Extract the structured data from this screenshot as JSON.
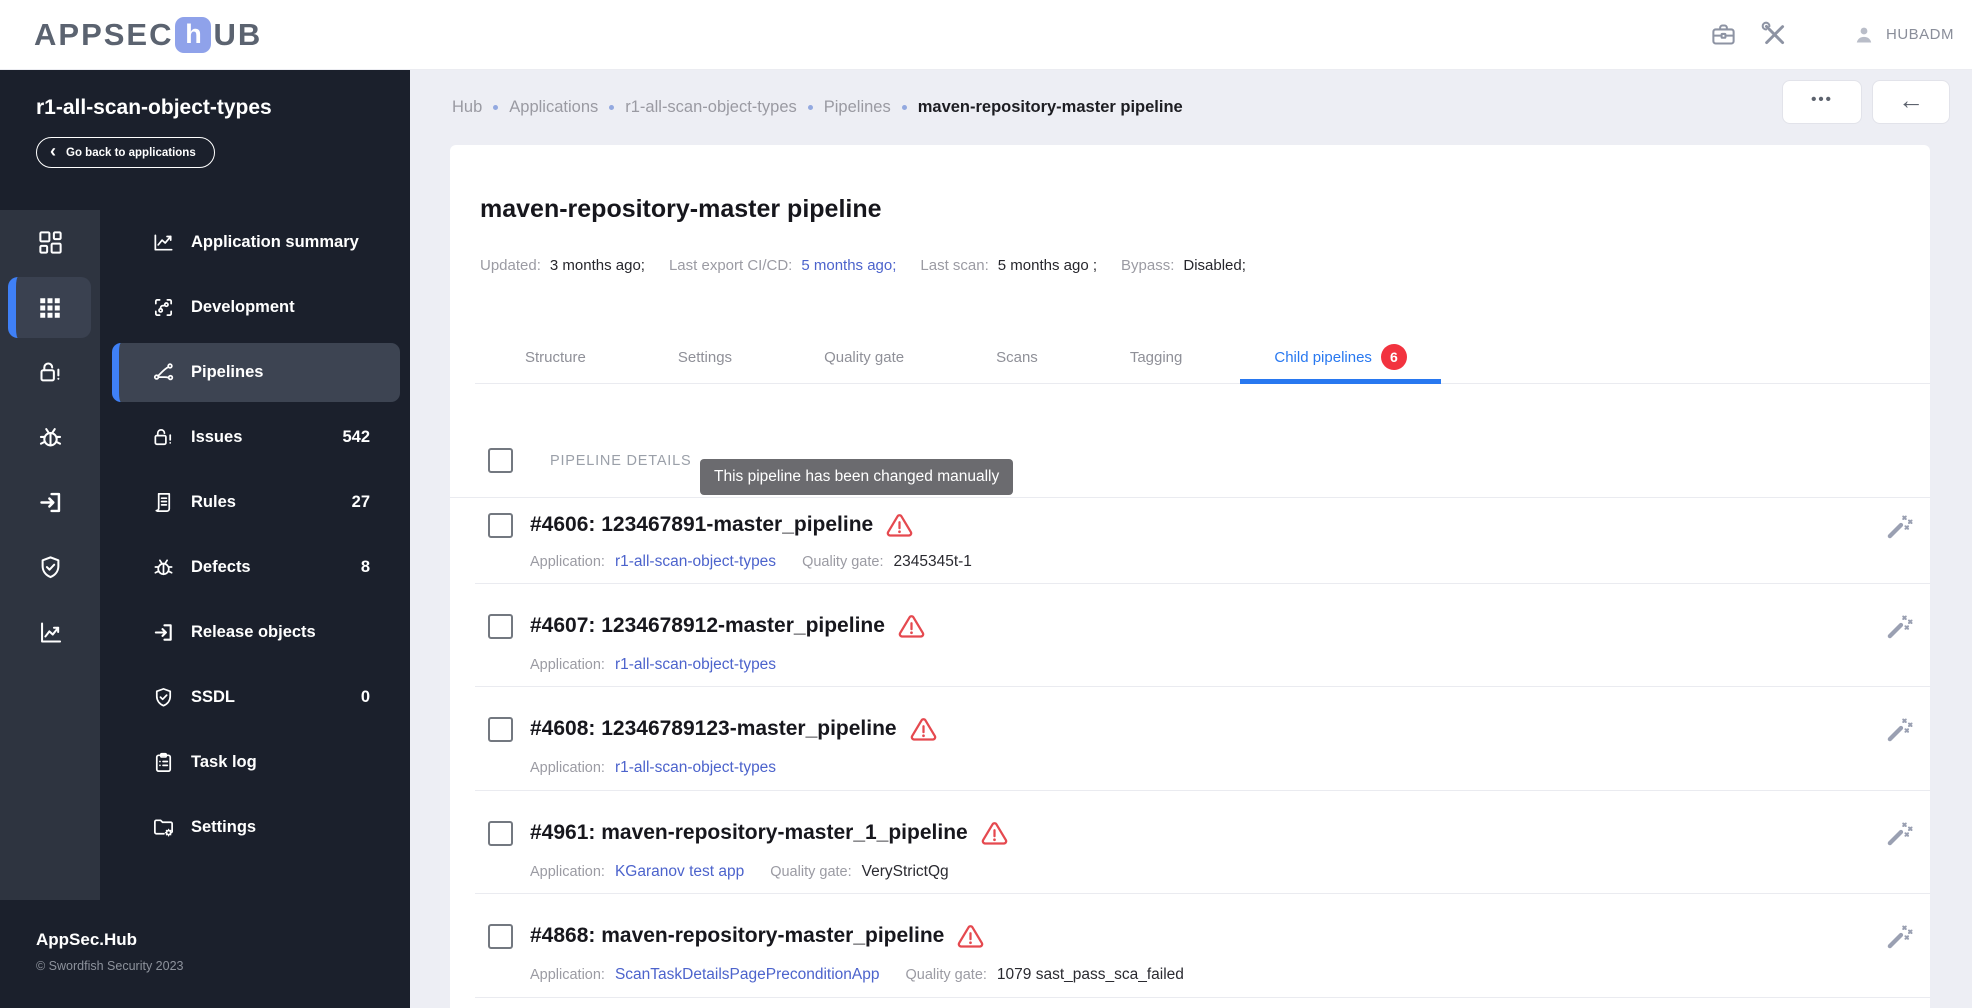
{
  "colors": {
    "accent_blue": "#2878f0",
    "link_blue": "#4c63cc",
    "badge_red": "#f2333f",
    "warning_red": "#e5494f",
    "sidebar_bg": "#1b202c",
    "rail_bg": "#2e3440",
    "active_item_bg": "#3d4452",
    "active_bar_blue": "#3f80f6",
    "page_bg": "#edeef4",
    "logo_block_blue": "#8fa2ea",
    "tooltip_bg": "#636367"
  },
  "icons": {
    "chevron_left": "‹",
    "more_button": "•••",
    "back_button": "←"
  },
  "header": {
    "logo_pre": "APPSEC",
    "logo_mid": "h",
    "logo_post": "UB",
    "username": "HUBADM"
  },
  "sidebar": {
    "app_title": "r1-all-scan-object-types",
    "back_label": "Go back to applications",
    "menu": [
      {
        "label": "Application summary"
      },
      {
        "label": "Development"
      },
      {
        "label": "Pipelines"
      },
      {
        "label": "Issues",
        "count": "542"
      },
      {
        "label": "Rules",
        "count": "27"
      },
      {
        "label": "Defects",
        "count": "8"
      },
      {
        "label": "Release objects"
      },
      {
        "label": "SSDL",
        "count": "0"
      },
      {
        "label": "Task log"
      },
      {
        "label": "Settings"
      }
    ],
    "footer_brand": "AppSec.Hub",
    "footer_copyright": "© Swordfish Security 2023"
  },
  "breadcrumb": {
    "items": [
      "Hub",
      "Applications",
      "r1-all-scan-object-types",
      "Pipelines"
    ],
    "current": "maven-repository-master pipeline"
  },
  "page": {
    "title": "maven-repository-master pipeline",
    "meta": [
      {
        "label": "Updated:",
        "value": "3 months ago;"
      },
      {
        "label": "Last export CI/CD:",
        "value": "5 months ago;",
        "link": true
      },
      {
        "label": "Last scan:",
        "value": "5 months ago ;"
      },
      {
        "label": "Bypass:",
        "value": "Disabled;"
      }
    ],
    "tabs": [
      {
        "label": "Structure"
      },
      {
        "label": "Settings"
      },
      {
        "label": "Quality gate"
      },
      {
        "label": "Scans"
      },
      {
        "label": "Tagging"
      },
      {
        "label": "Child pipelines",
        "badge": "6",
        "active": true
      }
    ],
    "list_header": "PIPELINE DETAILS",
    "tooltip": "This pipeline has been changed manually",
    "labels": {
      "application": "Application:",
      "quality_gate": "Quality gate:"
    },
    "rows": [
      {
        "title": "#4606: 123467891-master_pipeline",
        "application": "r1-all-scan-object-types",
        "quality_gate": "2345345t-1"
      },
      {
        "title": "#4607: 1234678912-master_pipeline",
        "application": "r1-all-scan-object-types"
      },
      {
        "title": "#4608: 12346789123-master_pipeline",
        "application": "r1-all-scan-object-types"
      },
      {
        "title": "#4961: maven-repository-master_1_pipeline",
        "application": "KGaranov test app",
        "quality_gate": "VeryStrictQg"
      },
      {
        "title": "#4868: maven-repository-master_pipeline",
        "application": "ScanTaskDetailsPagePreconditionApp",
        "quality_gate": "1079 sast_pass_sca_failed"
      }
    ]
  }
}
